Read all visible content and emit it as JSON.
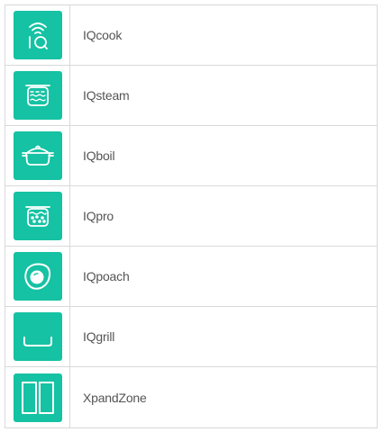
{
  "accent_color": "#15c2a3",
  "features": [
    {
      "label": "IQcook",
      "icon": "iq-wireless-icon"
    },
    {
      "label": "IQsteam",
      "icon": "steam-pot-icon"
    },
    {
      "label": "IQboil",
      "icon": "boil-pot-icon"
    },
    {
      "label": "IQpro",
      "icon": "pro-pot-icon"
    },
    {
      "label": "IQpoach",
      "icon": "fried-egg-icon"
    },
    {
      "label": "IQgrill",
      "icon": "grill-pan-icon"
    },
    {
      "label": "XpandZone",
      "icon": "xpandzone-icon"
    }
  ]
}
